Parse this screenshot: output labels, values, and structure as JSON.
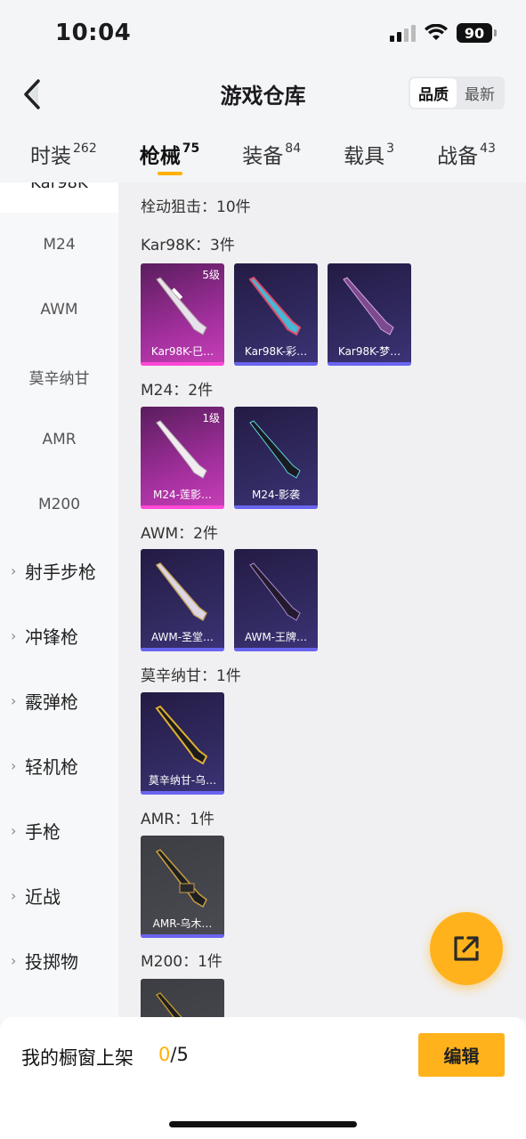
{
  "status_bar": {
    "time": "10:04",
    "battery": "90"
  },
  "header": {
    "title": "游戏仓库",
    "sort_options": [
      "品质",
      "最新"
    ],
    "active_sort": "品质"
  },
  "tabs": [
    {
      "label": "时装",
      "count": "262"
    },
    {
      "label": "枪械",
      "count": "75",
      "active": true
    },
    {
      "label": "装备",
      "count": "84"
    },
    {
      "label": "载具",
      "count": "3"
    },
    {
      "label": "战备",
      "count": "43"
    }
  ],
  "sidebar": {
    "partial_item": "Kar98K",
    "sub_items": [
      "M24",
      "AWM",
      "莫辛纳甘",
      "AMR",
      "M200"
    ],
    "categories": [
      "射手步枪",
      "冲锋枪",
      "霰弹枪",
      "轻机枪",
      "手枪",
      "近战",
      "投掷物"
    ]
  },
  "content": {
    "group_title": "栓动狙击：10件",
    "sections": [
      {
        "title": "Kar98K：3件",
        "cards": [
          {
            "name": "Kar98K-巳…",
            "level": "5级",
            "rarity": "pink"
          },
          {
            "name": "Kar98K-彩…",
            "rarity": "purple"
          },
          {
            "name": "Kar98K-梦…",
            "rarity": "purple"
          }
        ]
      },
      {
        "title": "M24：2件",
        "cards": [
          {
            "name": "M24-莲影…",
            "level": "1级",
            "rarity": "pink"
          },
          {
            "name": "M24-影袭",
            "rarity": "purple"
          }
        ]
      },
      {
        "title": "AWM：2件",
        "cards": [
          {
            "name": "AWM-圣堂…",
            "rarity": "purple"
          },
          {
            "name": "AWM-王牌…",
            "rarity": "purple"
          }
        ]
      },
      {
        "title": "莫辛纳甘：1件",
        "cards": [
          {
            "name": "莫辛纳甘-乌…",
            "rarity": "purple"
          }
        ]
      },
      {
        "title": "AMR：1件",
        "cards": [
          {
            "name": "AMR-乌木…",
            "rarity": "grey"
          }
        ]
      },
      {
        "title": "M200：1件",
        "cards": [
          {
            "name": "",
            "rarity": "grey"
          }
        ]
      }
    ]
  },
  "bottom": {
    "label": "我的橱窗上架",
    "current": "0",
    "total": "/5",
    "edit_label": "编辑"
  },
  "colors": {
    "accent": "#ffb21c",
    "pink": "#ff48d8",
    "purple": "#6a65f0"
  }
}
